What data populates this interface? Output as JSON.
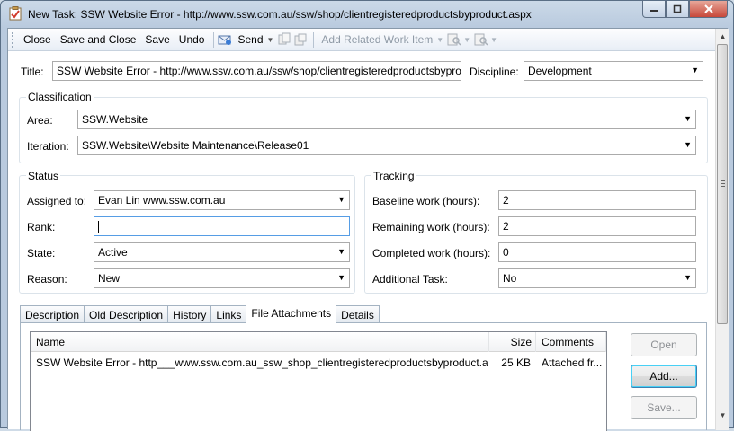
{
  "window": {
    "title": "New Task: SSW Website Error - http://www.ssw.com.au/ssw/shop/clientregisteredproductsbyproduct.aspx",
    "icon": "task-form-icon",
    "controls": [
      "minimize-icon",
      "maximize-icon",
      "close-icon"
    ]
  },
  "toolbar": {
    "close_label": "Close",
    "save_and_close_label": "Save and Close",
    "save_label": "Save",
    "undo_label": "Undo",
    "send_label": "Send",
    "add_related_label": "Add Related Work Item"
  },
  "form": {
    "title_label": "Title:",
    "title_value": "SSW Website Error - http://www.ssw.com.au/ssw/shop/clientregisteredproductsbyproduct.aspx",
    "discipline_label": "Discipline:",
    "discipline_value": "Development",
    "classification": {
      "heading": "Classification",
      "area_label": "Area:",
      "area_value": "SSW.Website",
      "iteration_label": "Iteration:",
      "iteration_value": "SSW.Website\\Website Maintenance\\Release01"
    },
    "status": {
      "heading": "Status",
      "assigned_label": "Assigned to:",
      "assigned_value": "Evan Lin www.ssw.com.au",
      "rank_label": "Rank:",
      "rank_value": "",
      "state_label": "State:",
      "state_value": "Active",
      "reason_label": "Reason:",
      "reason_value": "New"
    },
    "tracking": {
      "heading": "Tracking",
      "baseline_label": "Baseline work (hours):",
      "baseline_value": "2",
      "remaining_label": "Remaining work (hours):",
      "remaining_value": "2",
      "completed_label": "Completed work (hours):",
      "completed_value": "0",
      "additional_label": "Additional Task:",
      "additional_value": "No"
    }
  },
  "tabs": [
    "Description",
    "Old Description",
    "History",
    "Links",
    "File Attachments",
    "Details"
  ],
  "active_tab": "File Attachments",
  "attachments": {
    "columns": [
      "Name",
      "Size",
      "Comments"
    ],
    "rows": [
      {
        "name": "SSW Website Error - http___www.ssw.com.au_ssw_shop_clientregisteredproductsbyproduct.as...",
        "size": "25 KB",
        "comments": "Attached fr..."
      }
    ],
    "buttons": {
      "open": "Open",
      "add": "Add...",
      "save": "Save..."
    }
  },
  "colors": {
    "accent": "#569de5",
    "frame": "#b9cade",
    "disabled_text": "#8f9aa6"
  }
}
